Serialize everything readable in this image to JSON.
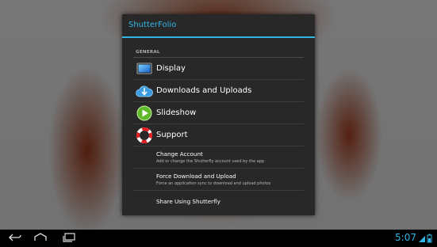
{
  "app": {
    "title": "ShutterFolio"
  },
  "section": {
    "general": "GENERAL"
  },
  "items": [
    {
      "label": "Display",
      "icon": "display-icon"
    },
    {
      "label": "Downloads and Uploads",
      "icon": "cloud-transfer-icon"
    },
    {
      "label": "Slideshow",
      "icon": "play-icon"
    },
    {
      "label": "Support",
      "icon": "lifebuoy-icon"
    }
  ],
  "settings": [
    {
      "title": "Change Account",
      "summary": "Add or change the Shutterfly account used by the app"
    },
    {
      "title": "Force Download and Upload",
      "summary": "Force an application sync to download and upload photos"
    },
    {
      "title": "Share Using Shutterfly",
      "summary": ""
    }
  ],
  "statusbar": {
    "time": "5:07"
  },
  "colors": {
    "accent": "#33b5e5",
    "dialog_bg": "#282828"
  }
}
